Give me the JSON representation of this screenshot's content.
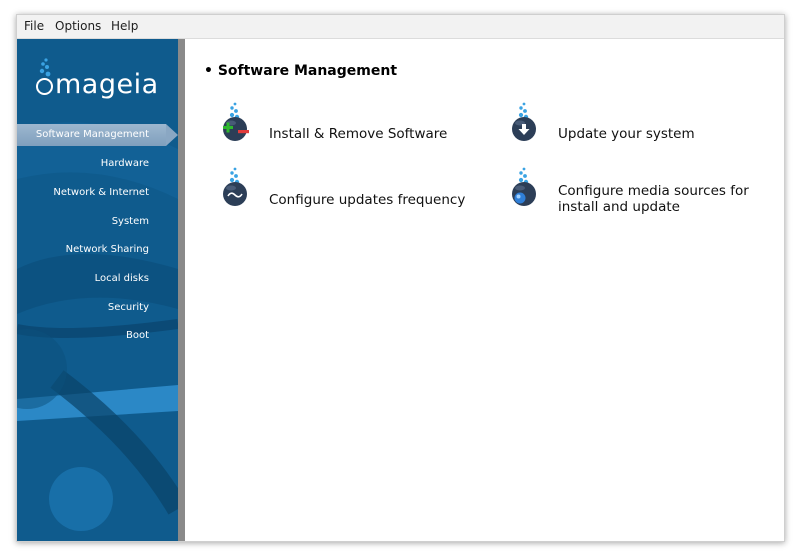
{
  "menubar": {
    "items": [
      "File",
      "Options",
      "Help"
    ]
  },
  "sidebar": {
    "logo_text": "mageia",
    "selected_index": 0,
    "items": [
      {
        "label": "Software Management"
      },
      {
        "label": "Hardware"
      },
      {
        "label": "Network & Internet"
      },
      {
        "label": "System"
      },
      {
        "label": "Network Sharing"
      },
      {
        "label": "Local disks"
      },
      {
        "label": "Security"
      },
      {
        "label": "Boot"
      }
    ]
  },
  "main": {
    "section_title": "• Software Management",
    "tools": [
      {
        "label": "Install & Remove Software",
        "icon": "install-remove-software-icon"
      },
      {
        "label": "Update your system",
        "icon": "update-system-icon"
      },
      {
        "label": "Configure updates frequency",
        "icon": "updates-frequency-icon"
      },
      {
        "label": "Configure media sources for install and update",
        "icon": "media-sources-icon"
      }
    ]
  },
  "colors": {
    "sidebar_bg": "#0f5b8d",
    "selected_item": "#8aa7c3",
    "icon_ball": "#2c3e57",
    "bubble": "#3aa3e3"
  }
}
